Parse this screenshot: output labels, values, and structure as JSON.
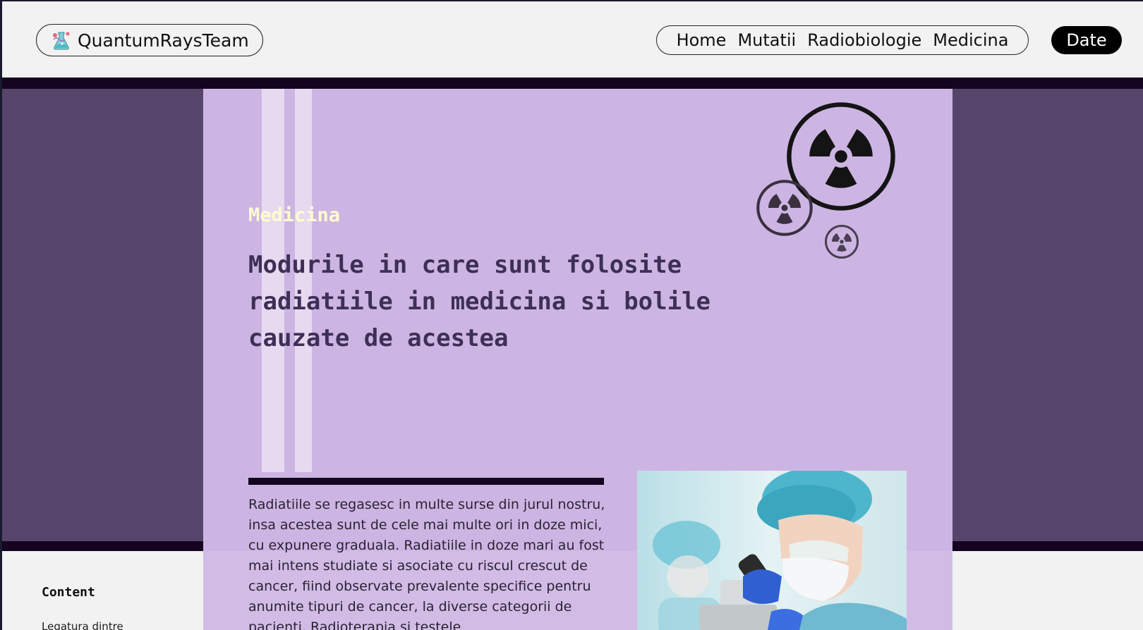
{
  "header": {
    "brand": "QuantumRaysTeam",
    "nav": [
      "Home",
      "Mutatii",
      "Radiobiologie",
      "Medicina"
    ],
    "date_label": "Date"
  },
  "hero": {
    "eyebrow": "Medicina",
    "title": "Modurile in care sunt folosite radiatiile in medicina si bolile cauzate de acestea",
    "body": "Radiatiile se regasesc in multe surse din jurul nostru, insa acestea sunt de cele mai multe ori in doze mici, cu expunere graduala. Radiatiile in doze mari au fost mai intens studiate si asociate cu riscul crescut de cancer, fiind observate prevalente specifice pentru anumite tipuri de cancer, la diverse categorii de pacienti. Radioterapia si testele"
  },
  "sidebar": {
    "heading": "Content",
    "items": [
      "Legatura dintre"
    ]
  },
  "icons": {
    "brand": "dna-flask-icon",
    "radiation": "radiation-icon"
  },
  "colors": {
    "hero_background": "#56446a",
    "panel": "#cdb5e3",
    "eyebrow": "#fffbd0",
    "title": "#3d2f56",
    "date_button": "#000000"
  }
}
